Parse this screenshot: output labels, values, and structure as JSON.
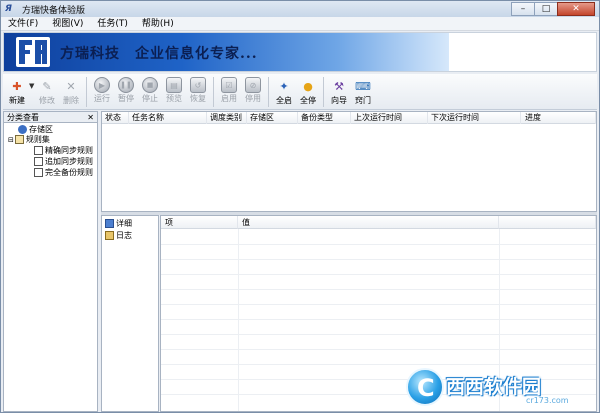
{
  "window": {
    "title": "方瑞快备体验版",
    "app_icon": "FR-app-icon",
    "controls": {
      "minimize": "–",
      "maximize": "□",
      "close": "✕"
    }
  },
  "menu": [
    "文件(F)",
    "视图(V)",
    "任务(T)",
    "帮助(H)"
  ],
  "banner": {
    "text": "方瑞科技　企业信息化专家...",
    "logo": "fr-logo-icon",
    "colors": {
      "dark": "#0e3f9c",
      "light": "#d6e8fb"
    }
  },
  "toolbar": [
    {
      "label": "新建",
      "icon": "new-task-icon",
      "enabled": true
    },
    {
      "label": "修改",
      "icon": "edit-icon",
      "enabled": false
    },
    {
      "label": "删除",
      "icon": "delete-icon",
      "enabled": false
    },
    {
      "label": "运行",
      "icon": "run-icon",
      "enabled": false
    },
    {
      "label": "暂停",
      "icon": "pause-icon",
      "enabled": false
    },
    {
      "label": "停止",
      "icon": "stop-icon",
      "enabled": false
    },
    {
      "label": "预览",
      "icon": "preview-icon",
      "enabled": false
    },
    {
      "label": "恢复",
      "icon": "restore-icon",
      "enabled": false
    },
    {
      "label": "启用",
      "icon": "enable-icon",
      "enabled": false
    },
    {
      "label": "停用",
      "icon": "disable-icon",
      "enabled": false
    },
    {
      "label": "全启",
      "icon": "start-all-icon",
      "enabled": true
    },
    {
      "label": "全停",
      "icon": "stop-all-icon",
      "enabled": true
    },
    {
      "label": "向导",
      "icon": "wizard-icon",
      "enabled": true
    },
    {
      "label": "窍门",
      "icon": "tips-icon",
      "enabled": true
    }
  ],
  "left_panel": {
    "title": "分类查看",
    "close": "✕",
    "tree": [
      {
        "label": "存储区",
        "level": 0,
        "icon": "storage-icon"
      },
      {
        "label": "规则集",
        "level": 0,
        "icon": "ruleset-icon"
      },
      {
        "label": "精确同步规则",
        "level": 1,
        "icon": "rule-icon"
      },
      {
        "label": "追加同步规则",
        "level": 1,
        "icon": "rule-icon"
      },
      {
        "label": "完全备份规则",
        "level": 1,
        "icon": "rule-icon"
      }
    ]
  },
  "task_table": {
    "columns": [
      "状态",
      "任务名称",
      "调度类别",
      "存储区",
      "备份类型",
      "上次运行时间",
      "下次运行时间",
      "进度"
    ],
    "rows": []
  },
  "detail_nav": [
    {
      "label": "详细",
      "icon": "detail-icon"
    },
    {
      "label": "日志",
      "icon": "log-icon"
    }
  ],
  "detail_table": {
    "columns": [
      "项",
      "值"
    ]
  },
  "watermark": {
    "main": "西西软件园",
    "sub": "cr173.com",
    "logo_letter": "C"
  }
}
